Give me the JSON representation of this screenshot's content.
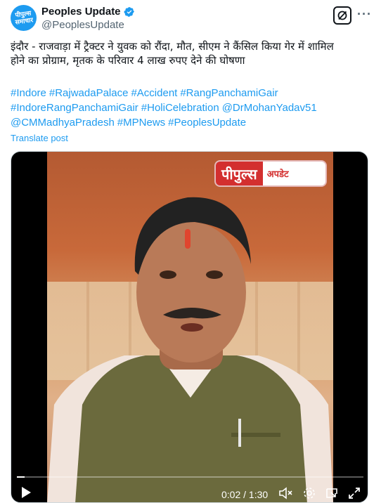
{
  "account": {
    "avatar_text_line1": "पीपुल्स",
    "avatar_text_line2": "समाचार",
    "display_name": "Peoples Update",
    "handle": "@PeoplesUpdate",
    "verified_color": "#1d9bf0"
  },
  "tweet": {
    "text_line1": "इंदौर - राजवाड़ा में ट्रैक्टर ने युवक को रौंदा, मौत, सीएम ने कैंसिल किया गेर में शामिल",
    "text_line2": "होने का प्रोग्राम, मृतक के परिवार 4 लाख रुपए देने की घोषणा",
    "hashtags": [
      "#Indore",
      "#RajwadaPalace",
      "#Accident",
      "#RangPanchamiGair",
      "#IndoreRangPanchamiGair",
      "#HoliCelebration",
      "@DrMohanYadav51",
      "@CMMadhyaPradesh",
      "#MPNews",
      "#PeoplesUpdate"
    ],
    "translate_label": "Translate post"
  },
  "video": {
    "logo_left": "पीपुल्स",
    "logo_right": "अपडेट",
    "time_display": "0:02 / 1:30",
    "progress": 0.022
  },
  "icons": {
    "grok": "grok-icon",
    "more": "more-icon",
    "play": "play-icon",
    "mute": "volume-mute-icon",
    "settings": "gear-icon",
    "pip": "picture-in-picture-icon",
    "fullscreen": "fullscreen-icon"
  },
  "colors": {
    "accent": "#1d9bf0",
    "text": "#0f1419",
    "muted": "#536471"
  }
}
